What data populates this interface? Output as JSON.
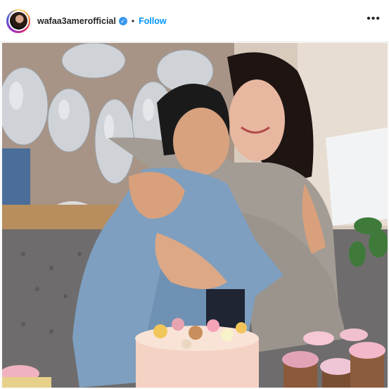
{
  "post": {
    "username": "wafaa3amerofficial",
    "verified_glyph": "✓",
    "separator": "•",
    "follow_label": "Follow",
    "more_glyph": "•••"
  },
  "icons": [
    "avatar",
    "verified-badge-icon",
    "more-options-icon"
  ],
  "colors": {
    "follow_blue": "#0095f6",
    "verified_blue": "#3897f0",
    "username_text": "#262626"
  }
}
